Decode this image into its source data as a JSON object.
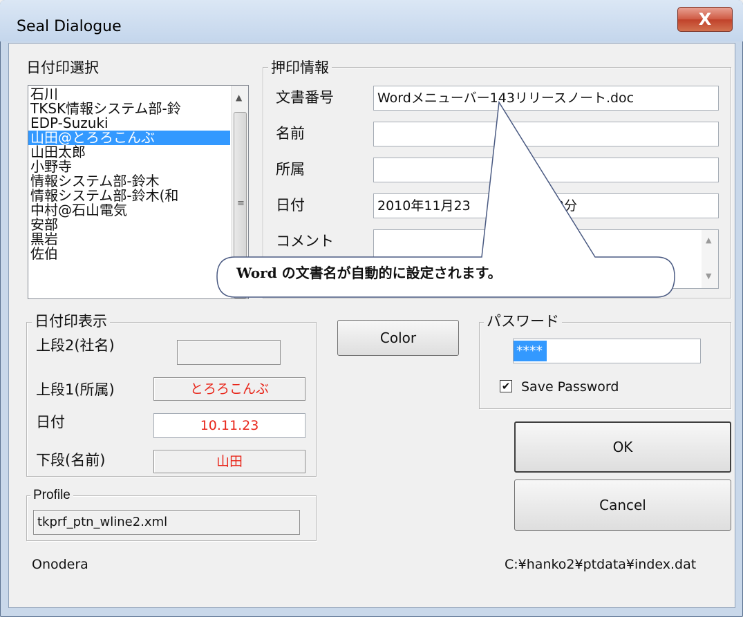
{
  "window": {
    "title": "Seal Dialogue",
    "close_label": "X"
  },
  "seal_select": {
    "legend": "日付印選択",
    "items": [
      "石川",
      "TKSK情報システム部-鈴",
      "EDP-Suzuki",
      "山田@とろろこんぶ",
      "山田太郎",
      "小野寺",
      "情報システム部-鈴木",
      "情報システム部-鈴木(和",
      "中村@石山電気",
      "安部",
      "黒岩",
      "佐伯"
    ],
    "selected_index": 3
  },
  "seal_info": {
    "legend": "押印情報",
    "doc_no_label": "文書番号",
    "doc_no_value": "Wordメニューバー143リリースノート.doc",
    "name_label": "名前",
    "name_value": "",
    "dept_label": "所属",
    "dept_value": "",
    "date_label": "日付",
    "date_value": "2010年11月23",
    "date_value_tail": "時32分",
    "comment_label": "コメント",
    "comment_value": ""
  },
  "callout": {
    "text": "Word の文書名が自動的に設定されます。"
  },
  "seal_display": {
    "legend": "日付印表示",
    "upper2_label": "上段2(社名)",
    "upper2_value": "",
    "upper1_label": "上段1(所属)",
    "upper1_value": "とろろこんぶ",
    "date_label": "日付",
    "date_value": "10.11.23",
    "lower_label": "下段(名前)",
    "lower_value": "山田",
    "value_color": "#e8261a"
  },
  "color_button": "Color",
  "password": {
    "legend": "パスワード",
    "value": "****",
    "save_checked": true,
    "save_label": "Save Password"
  },
  "ok_button": "OK",
  "cancel_button": "Cancel",
  "profile": {
    "legend": "Profile",
    "value": "tkprf_ptn_wline2.xml"
  },
  "status": {
    "user": "Onodera",
    "path": "C:¥hanko2¥ptdata¥index.dat"
  }
}
